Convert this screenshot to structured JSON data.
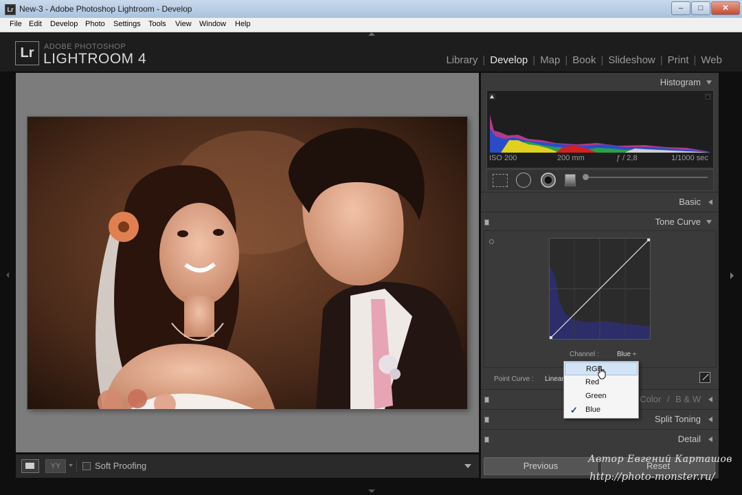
{
  "window": {
    "app_icon": "Lr",
    "title": "New-3 - Adobe Photoshop Lightroom - Develop",
    "minimize": "–",
    "maximize": "□",
    "close": "✕"
  },
  "menu": [
    "File",
    "Edit",
    "Develop",
    "Photo",
    "Settings",
    "Tools",
    "View",
    "Window",
    "Help"
  ],
  "header": {
    "logo": "Lr",
    "brand_small": "ADOBE PHOTOSHOP",
    "brand_big": "LIGHTROOM 4",
    "modules": [
      "Library",
      "Develop",
      "Map",
      "Book",
      "Slideshow",
      "Print",
      "Web"
    ],
    "active_module": "Develop"
  },
  "toolbar": {
    "yy_label": "YY",
    "soft_proofing_label": "Soft Proofing",
    "soft_proofing_checked": false
  },
  "histogram_panel": {
    "title": "Histogram",
    "iso": "ISO 200",
    "focal": "200 mm",
    "aperture": "ƒ / 2,8",
    "shutter": "1/1000 sec"
  },
  "panels": {
    "basic": "Basic",
    "tone_curve": "Tone Curve",
    "hsl_color": "Color",
    "hsl_bw": "B & W",
    "hsl_sep": "/",
    "split_toning": "Split Toning",
    "detail": "Detail"
  },
  "tone_curve": {
    "channel_label": "Channel :",
    "channel_value": "Blue ÷",
    "point_curve_label": "Point Curve :",
    "point_curve_value": "Linear"
  },
  "channel_dropdown": {
    "options": [
      "RGB",
      "Red",
      "Green",
      "Blue"
    ],
    "selected": "Blue",
    "hovered": "RGB"
  },
  "buttons": {
    "previous": "Previous",
    "reset": "Reset"
  },
  "watermark": {
    "line1": "Автор Евгений Карташов",
    "line2": "http://photo-monster.ru/"
  },
  "icons": {
    "window_app": "lightroom-app-icon",
    "crop": "crop-overlay-icon",
    "spot": "spot-removal-icon",
    "redeye": "red-eye-icon",
    "graduated": "graduated-filter-icon",
    "brush": "adjustment-brush-icon"
  }
}
